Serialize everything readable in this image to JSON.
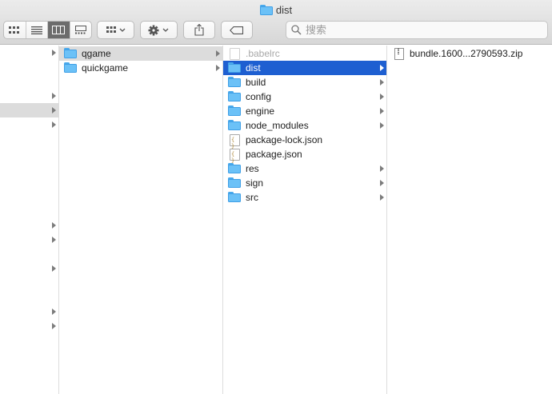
{
  "window": {
    "title": "dist"
  },
  "toolbar": {
    "view_modes": [
      "icon-view",
      "list-view",
      "column-view",
      "gallery-view"
    ],
    "active_view": "column-view",
    "group_icon": "grid-icon",
    "action_icon": "gear-icon",
    "share_icon": "share-icon",
    "tag_icon": "tag-icon"
  },
  "search": {
    "placeholder": "搜索"
  },
  "columns": {
    "col2": {
      "items": [
        {
          "name": "qgame",
          "type": "folder",
          "has_children": true,
          "state": "selected-inactive"
        },
        {
          "name": "quickgame",
          "type": "folder",
          "has_children": true,
          "state": "normal"
        }
      ]
    },
    "col3": {
      "items": [
        {
          "name": ".babelrc",
          "type": "file-hidden",
          "has_children": false,
          "state": "dim"
        },
        {
          "name": "dist",
          "type": "folder",
          "has_children": true,
          "state": "selected"
        },
        {
          "name": "build",
          "type": "folder",
          "has_children": true,
          "state": "normal"
        },
        {
          "name": "config",
          "type": "folder",
          "has_children": true,
          "state": "normal"
        },
        {
          "name": "engine",
          "type": "folder",
          "has_children": true,
          "state": "normal"
        },
        {
          "name": "node_modules",
          "type": "folder",
          "has_children": true,
          "state": "normal"
        },
        {
          "name": "package-lock.json",
          "type": "json",
          "has_children": false,
          "state": "normal"
        },
        {
          "name": "package.json",
          "type": "json",
          "has_children": false,
          "state": "normal"
        },
        {
          "name": "res",
          "type": "folder",
          "has_children": true,
          "state": "normal"
        },
        {
          "name": "sign",
          "type": "folder",
          "has_children": true,
          "state": "normal"
        },
        {
          "name": "src",
          "type": "folder",
          "has_children": true,
          "state": "normal"
        }
      ]
    },
    "col4": {
      "items": [
        {
          "name": "bundle.1600...2790593.zip",
          "type": "zip",
          "has_children": false,
          "state": "normal"
        }
      ]
    }
  },
  "colors": {
    "selection_blue": "#1e5fd1",
    "selection_gray": "#dcdcdc",
    "folder_blue": "#6bc1f7"
  }
}
